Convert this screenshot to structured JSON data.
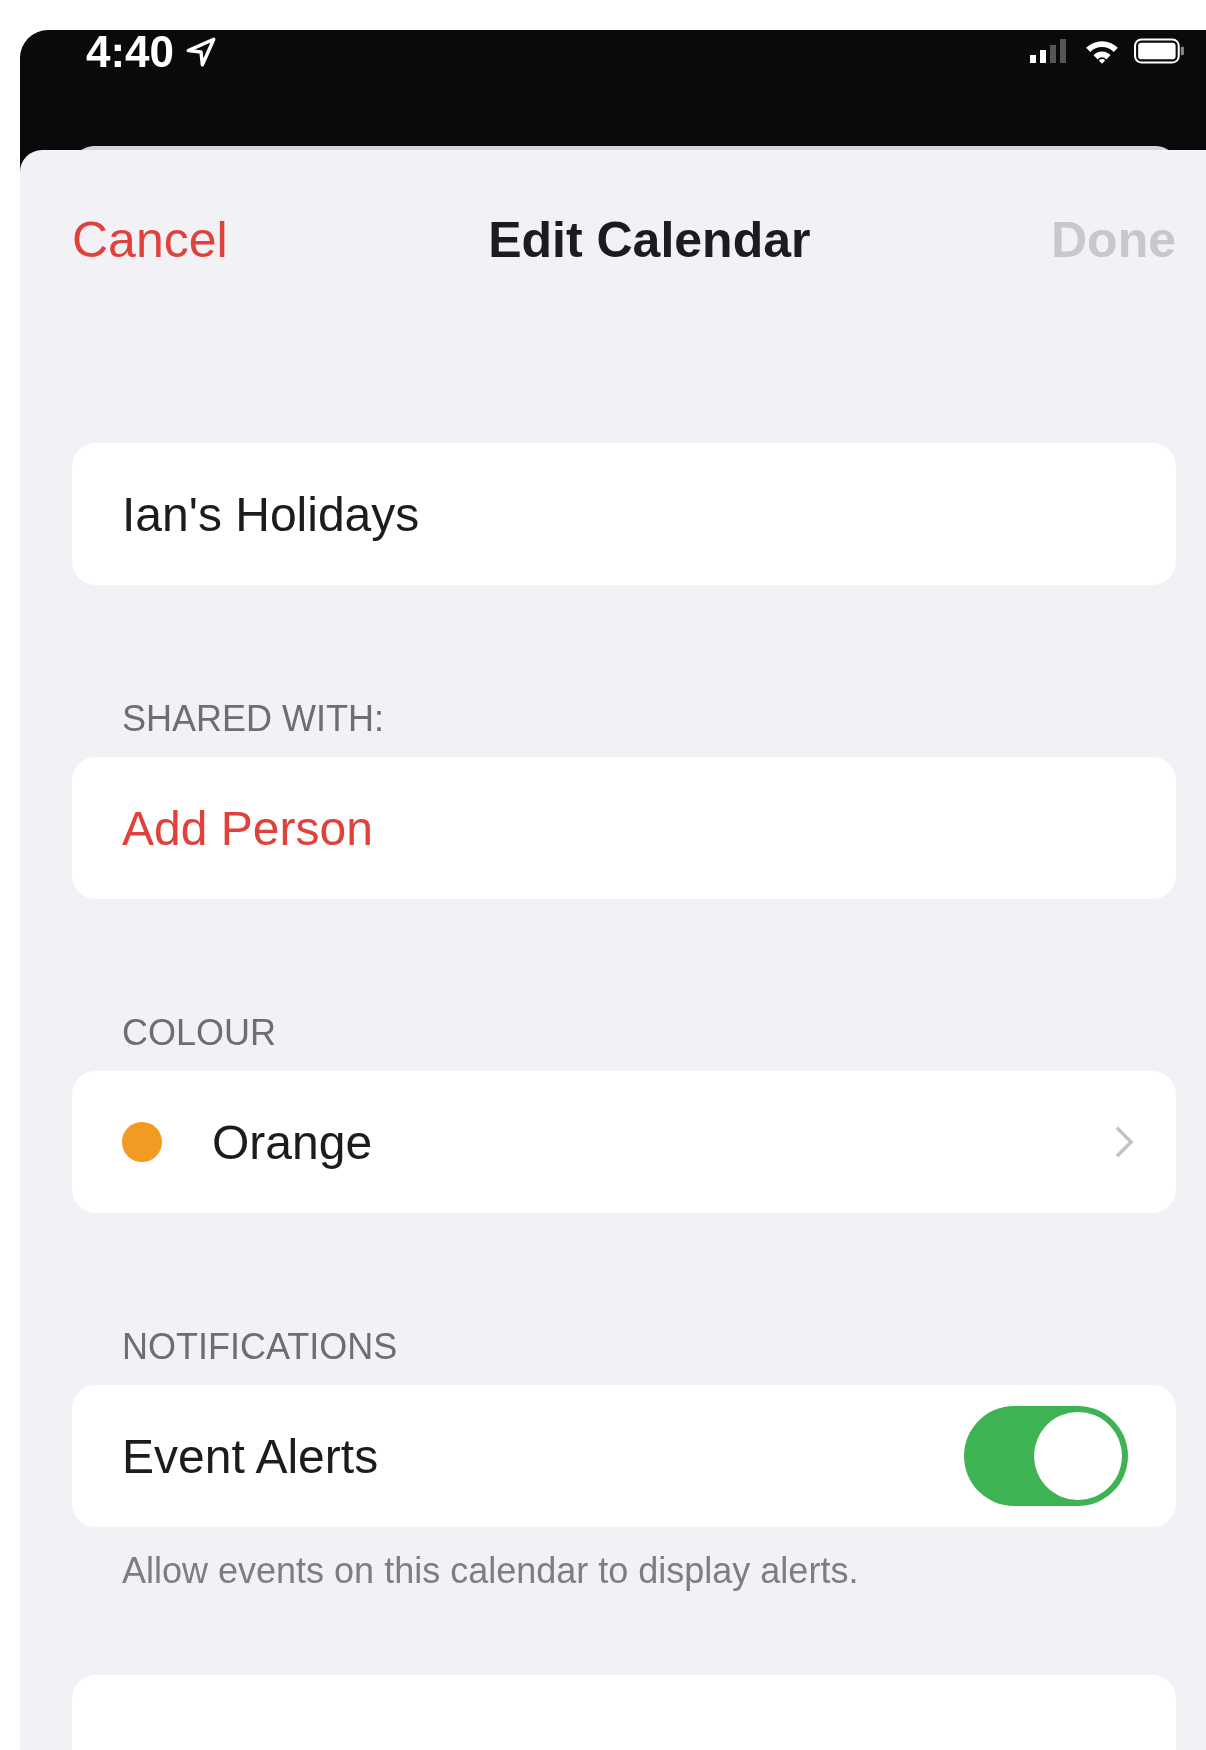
{
  "status_bar": {
    "time": "4:40"
  },
  "nav": {
    "cancel": "Cancel",
    "title": "Edit Calendar",
    "done": "Done",
    "done_disabled": true
  },
  "name_field": {
    "value": "Ian's Holidays"
  },
  "shared": {
    "header": "SHARED WITH:",
    "add_person": "Add Person"
  },
  "colour": {
    "header": "COLOUR",
    "name": "Orange",
    "color": "#f39a22"
  },
  "notifications": {
    "header": "NOTIFICATIONS",
    "label": "Event Alerts",
    "on": true,
    "footer": "Allow events on this calendar to display alerts."
  }
}
